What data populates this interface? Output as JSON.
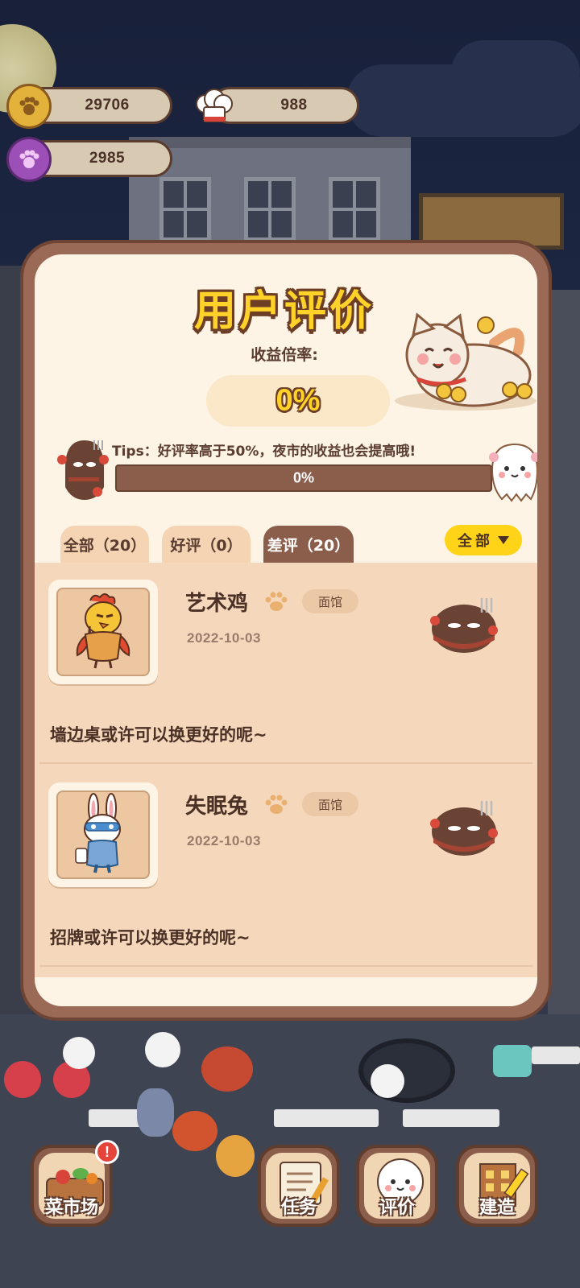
{
  "resources": {
    "paw_coins": "29706",
    "chef_hats": "988",
    "purple_paws": "2985"
  },
  "modal": {
    "title": "用户评价",
    "rate_label": "收益倍率:",
    "rate_value": "0%",
    "tips": "Tips：好评率高于50%，夜市的收益也会提高哦!",
    "good_rate_progress": 0,
    "progress_text": "0%"
  },
  "tabs": [
    {
      "label": "全部（20）",
      "active": false
    },
    {
      "label": "好评（0）",
      "active": false
    },
    {
      "label": "差评（20）",
      "active": true
    }
  ],
  "filter": {
    "label": "全部",
    "icon": "triangle-down-icon"
  },
  "reviews": [
    {
      "name": "艺术鸡",
      "tag": "面馆",
      "date": "2022-10-03",
      "comment": "墙边桌或许可以换更好的呢~",
      "rating": "bad",
      "avatar": "chicken"
    },
    {
      "name": "失眠兔",
      "tag": "面馆",
      "date": "2022-10-03",
      "comment": "招牌或许可以换更好的呢~",
      "rating": "bad",
      "avatar": "rabbit"
    }
  ],
  "nav": {
    "market": "菜市场",
    "tasks": "任务",
    "reviews": "评价",
    "build": "建造",
    "market_badge": "!"
  },
  "colors": {
    "accent_yellow": "#ffd22a",
    "frame_brown": "#9b6a56",
    "panel_cream": "#fdf4e6",
    "list_bg": "#f5d8bc"
  }
}
